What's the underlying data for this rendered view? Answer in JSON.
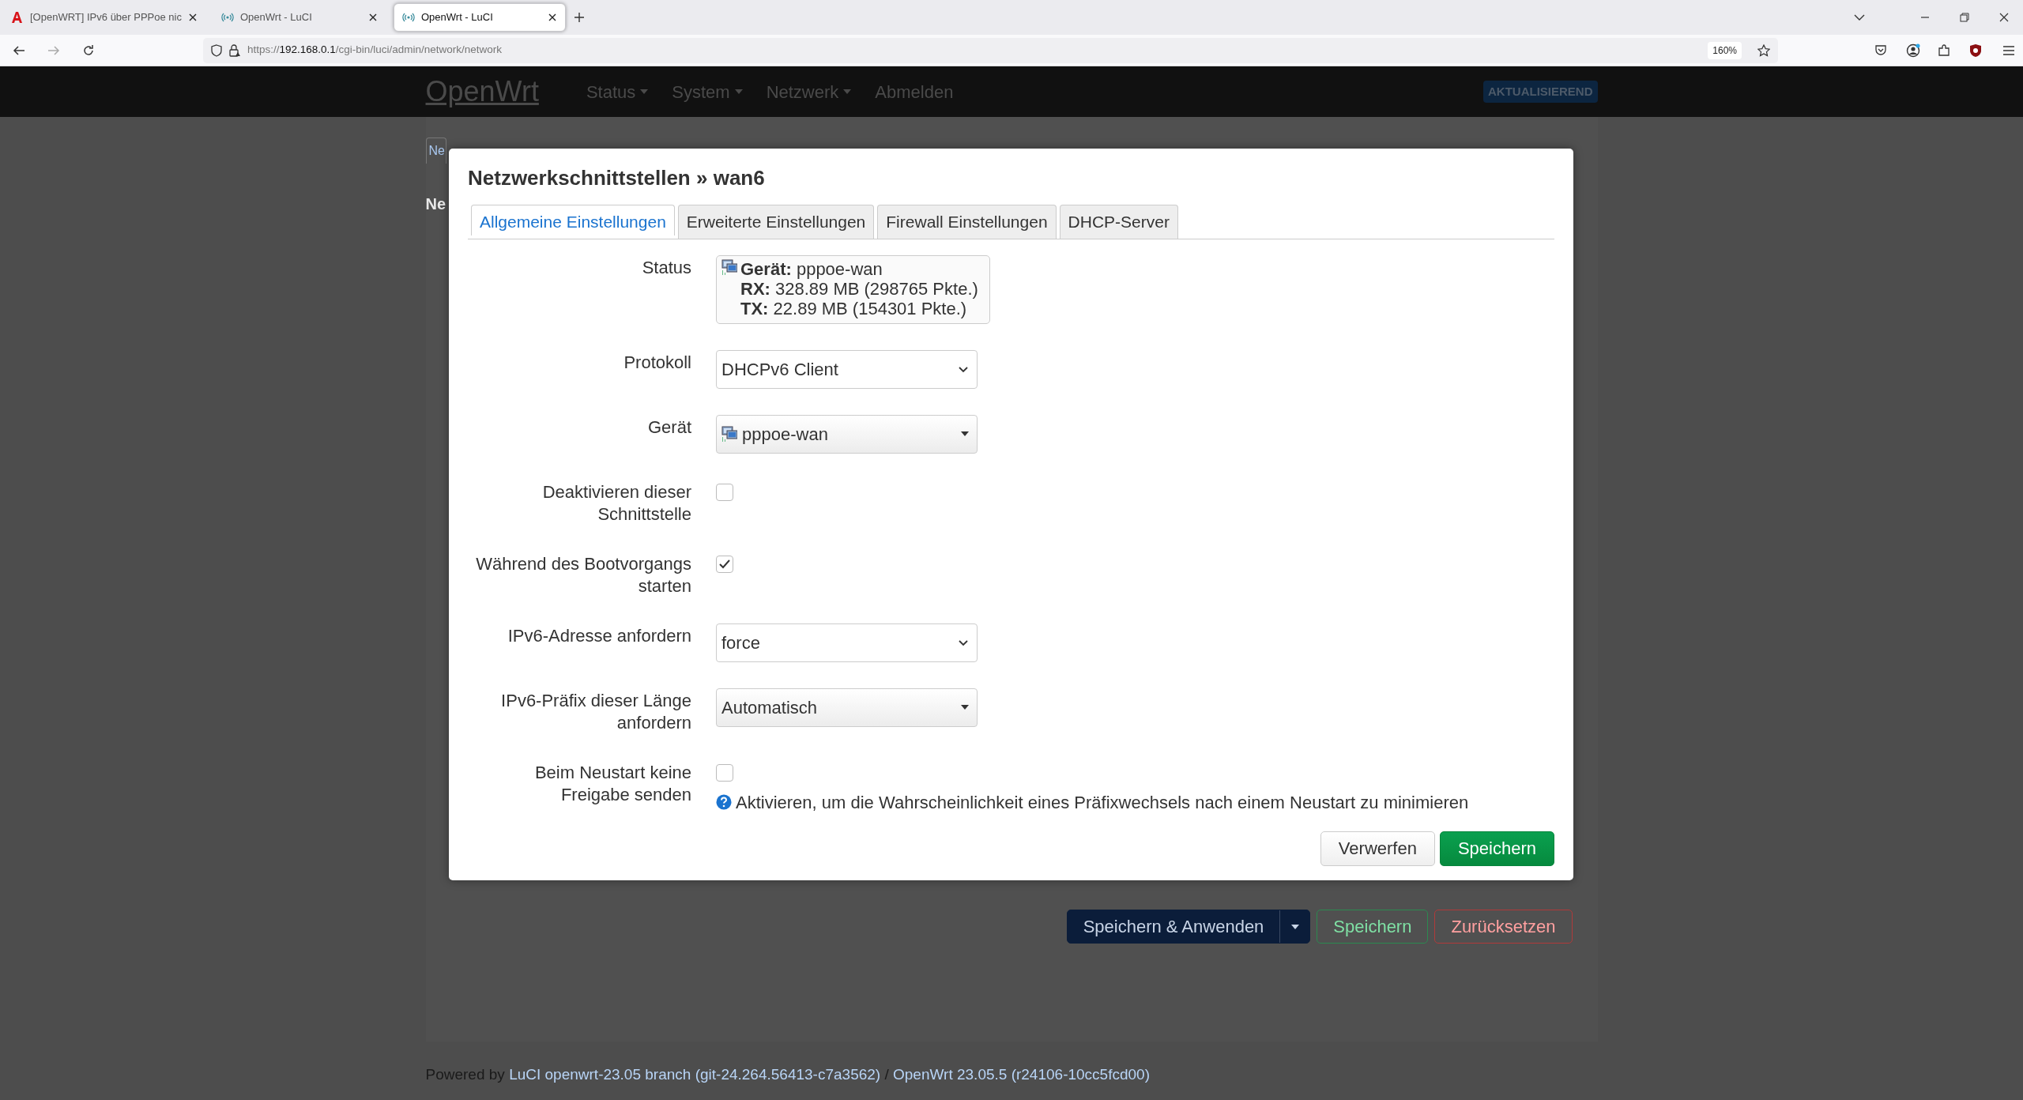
{
  "browser": {
    "tabs": [
      {
        "title": "[OpenWRT] IPv6 über PPPoe nic",
        "kind": "site",
        "selected": false
      },
      {
        "title": "OpenWrt - LuCI",
        "kind": "luci",
        "selected": false
      },
      {
        "title": "OpenWrt - LuCI",
        "kind": "luci",
        "selected": true
      }
    ],
    "url_scheme": "https://",
    "url_host": "192.168.0.1",
    "url_path": "/cgi-bin/luci/admin/network/network",
    "zoom": "160%"
  },
  "navbar": {
    "brand": "OpenWrt",
    "items": [
      {
        "label": "Status",
        "dropdown": true
      },
      {
        "label": "System",
        "dropdown": true
      },
      {
        "label": "Netzwerk",
        "dropdown": true
      },
      {
        "label": "Abmelden",
        "dropdown": false
      }
    ],
    "badge": "AKTUALISIEREND"
  },
  "page": {
    "tab": "Ne",
    "heading": "Ne",
    "actions": [
      {
        "label": "Speichern & Anwenden",
        "kind": "apply"
      },
      {
        "label": "Speichern",
        "kind": "save"
      },
      {
        "label": "Zurücksetzen",
        "kind": "reset"
      }
    ]
  },
  "modal": {
    "title": "Netzwerkschnittstellen » wan6",
    "tabs": [
      {
        "label": "Allgemeine Einstellungen",
        "selected": true
      },
      {
        "label": "Erweiterte Einstellungen",
        "selected": false
      },
      {
        "label": "Firewall Einstellungen",
        "selected": false
      },
      {
        "label": "DHCP-Server",
        "selected": false
      }
    ],
    "fields": [
      {
        "kind": "status",
        "label": "Status",
        "lines": [
          "**Gerät:** pppoe-wan",
          "**RX:** 328.89 MB (298765 Pkte.)",
          "**TX:** 22.89 MB (154301 Pkte.)"
        ]
      },
      {
        "kind": "select",
        "label": "Protokoll",
        "value": "DHCPv6 Client"
      },
      {
        "kind": "device",
        "label": "Gerät",
        "value": "pppoe-wan"
      },
      {
        "kind": "checkbox",
        "label": "Deaktivieren dieser Schnittstelle",
        "checked": false
      },
      {
        "kind": "checkbox",
        "label": "Während des Bootvorgangs starten",
        "checked": true
      },
      {
        "kind": "select",
        "label": "IPv6-Adresse anfordern",
        "value": "force"
      },
      {
        "kind": "dropdown",
        "label": "IPv6-Präfix dieser Länge anfordern",
        "value": "Automatisch"
      },
      {
        "kind": "checkbox",
        "label": "Beim Neustart keine Freigabe senden",
        "checked": false,
        "help": "Aktivieren, um die Wahrscheinlichkeit eines Präfixwechsels nach einem Neustart zu minimieren"
      }
    ],
    "buttons": [
      {
        "label": "Verwerfen",
        "kind": "default"
      },
      {
        "label": "Speichern",
        "kind": "primary"
      }
    ]
  },
  "footer": {
    "prefix": "Powered by",
    "links": [
      "LuCI openwrt-23.05 branch (git-24.264.56413-c7a3562)",
      "OpenWrt 23.05.5 (r24106-10cc5fcd00)"
    ],
    "separator": "/"
  }
}
